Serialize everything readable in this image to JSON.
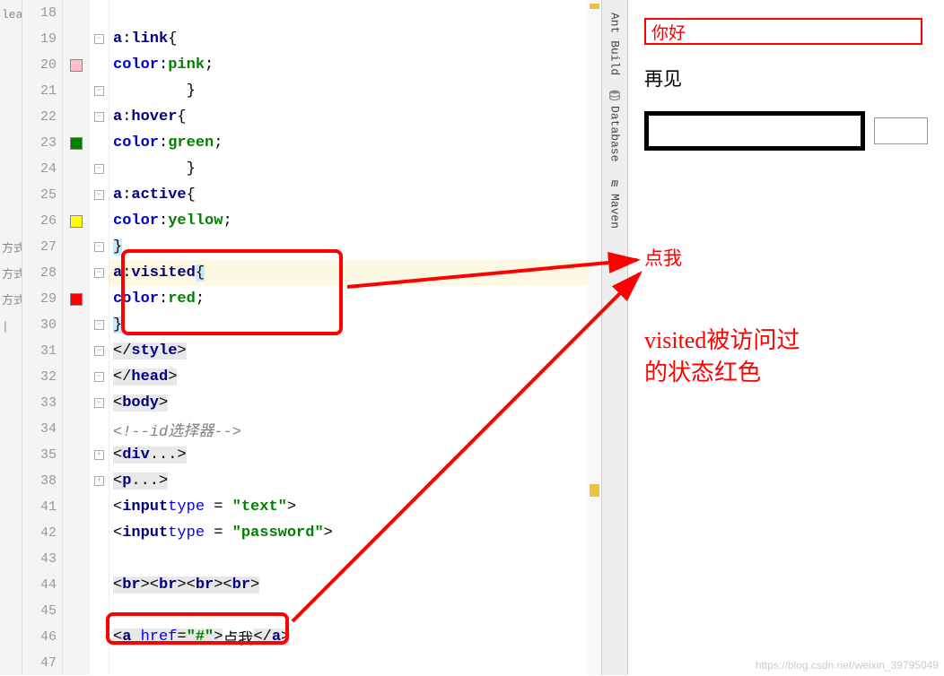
{
  "left_fragment": [
    "leav",
    "",
    "",
    "",
    "",
    "",
    "",
    "",
    "",
    "方式",
    "方式",
    "方式",
    "|"
  ],
  "lines": [
    {
      "n": "18",
      "marker": "",
      "fold": "",
      "code": ""
    },
    {
      "n": "19",
      "marker": "",
      "fold": "⊖",
      "code_html": "        <span class='sel'>a</span>:<span class='sel'>link</span>{"
    },
    {
      "n": "20",
      "marker": "pink",
      "fold": "",
      "code_html": "            <span class='prop'>color</span>:<span class='val-pink'>pink</span>;"
    },
    {
      "n": "21",
      "marker": "",
      "fold": "⊖",
      "code_html": "        }"
    },
    {
      "n": "22",
      "marker": "",
      "fold": "⊖",
      "code_html": "        <span class='sel'>a</span>:<span class='sel'>hover</span>{"
    },
    {
      "n": "23",
      "marker": "green",
      "fold": "",
      "code_html": "            <span class='prop'>color</span>:<span class='val-green'>green</span>;"
    },
    {
      "n": "24",
      "marker": "",
      "fold": "⊖",
      "code_html": "        }"
    },
    {
      "n": "25",
      "marker": "",
      "fold": "⊖",
      "code_html": "        <span class='sel'>a</span>:<span class='sel'>active</span>{"
    },
    {
      "n": "26",
      "marker": "yellow",
      "fold": "",
      "code_html": "            <span class='prop'>color</span>:<span class='val-yellow'>yellow</span>;"
    },
    {
      "n": "27",
      "marker": "",
      "fold": "⊖",
      "code_html": "        <span class='selbg'>}</span>"
    },
    {
      "n": "28",
      "marker": "",
      "fold": "⊖",
      "hl": true,
      "code_html": "        <span class='sel'>a</span>:<span class='sel'>visited</span><span class='selbg'>{</span>"
    },
    {
      "n": "29",
      "marker": "red",
      "fold": "",
      "code_html": "            <span class='prop'>color</span>:<span class='val-red'>red</span>;"
    },
    {
      "n": "30",
      "marker": "",
      "fold": "⊖",
      "code_html": "        <span class='selbg'>}</span>"
    },
    {
      "n": "31",
      "marker": "",
      "fold": "⊖",
      "code_html": "    <span class='grey-bg'>&lt;/<span class='tag'>style</span>&gt;</span>"
    },
    {
      "n": "32",
      "marker": "",
      "fold": "⊖",
      "code_html": "<span class='grey-bg'>&lt;/<span class='tag'>head</span>&gt;</span>"
    },
    {
      "n": "33",
      "marker": "",
      "fold": "⊖",
      "code_html": "<span class='grey-bg'>&lt;<span class='tag'>body</span>&gt;</span>"
    },
    {
      "n": "34",
      "marker": "",
      "fold": "",
      "code_html": "<span class='cmt'>&lt;!--id选择器--&gt;</span>"
    },
    {
      "n": "35",
      "marker": "",
      "fold": "⊞",
      "code_html": "<span class='grey-bg'>&lt;<span class='tag'>div</span>...&gt;</span>"
    },
    {
      "n": "38",
      "marker": "",
      "fold": "⊞",
      "code_html": "<span class='grey-bg'>&lt;<span class='tag'>p</span>...&gt;</span>"
    },
    {
      "n": "41",
      "marker": "",
      "fold": "",
      "code_html": "&lt;<span class='tag'>input</span> <span class='attr'>type</span> = <span class='str'>\"text\"</span>&gt;"
    },
    {
      "n": "42",
      "marker": "",
      "fold": "",
      "code_html": "&lt;<span class='tag'>input</span> <span class='attr'>type</span> = <span class='str'>\"password\"</span>&gt;"
    },
    {
      "n": "43",
      "marker": "",
      "fold": "",
      "code_html": ""
    },
    {
      "n": "44",
      "marker": "",
      "fold": "",
      "code_html": "<span class='grey-bg'>&lt;<span class='tag'>br</span>&gt;&lt;<span class='tag'>br</span>&gt;&lt;<span class='tag'>br</span>&gt;&lt;<span class='tag'>br</span>&gt;</span>"
    },
    {
      "n": "45",
      "marker": "",
      "fold": "",
      "code_html": ""
    },
    {
      "n": "46",
      "marker": "",
      "fold": "",
      "code_html": "<span class='grey-bg'>&lt;<span class='tag'>a</span> <span class='attr'>href</span>=<span class='str'>\"#\"</span>&gt;</span>点我<span class='grey-bg'>&lt;/<span class='tag'>a</span>&gt;</span>"
    },
    {
      "n": "47",
      "marker": "",
      "fold": "",
      "code_html": ""
    }
  ],
  "side_tabs": [
    {
      "label": "Ant Build",
      "icon": "ant"
    },
    {
      "label": "Database",
      "icon": "db"
    },
    {
      "label": "Maven",
      "icon": "m"
    }
  ],
  "preview": {
    "input_value": "你好",
    "plain_text": "再见",
    "link_text": "点我",
    "annotation_l1": "visited被访问过",
    "annotation_l2": "的状态红色"
  },
  "watermark": "https://blog.csdn.net/weixin_39795049"
}
